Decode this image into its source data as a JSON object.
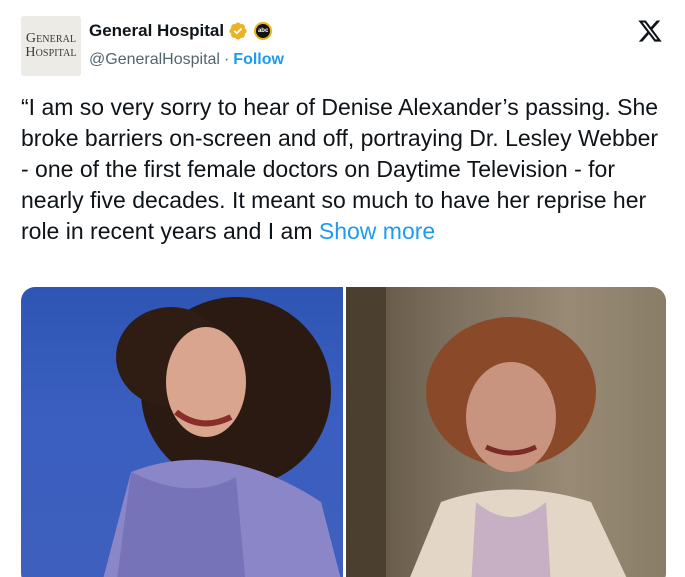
{
  "account": {
    "name": "General Hospital",
    "handle": "@GeneralHospital",
    "separator": "·",
    "follow_label": "Follow",
    "avatar_text_line1": "General",
    "avatar_text_line2": "Hospital",
    "affiliate_badge_text": "abc",
    "verified": true
  },
  "tweet": {
    "text": "“I am so very sorry to hear of Denise Alexander’s passing. She broke barriers on-screen and off, portraying Dr. Lesley Webber - one of the first female doctors on Daytime Television - for nearly five decades. It meant so much to have her reprise her role in recent years and I am ",
    "show_more_label": "Show more"
  },
  "media": {
    "count": 2,
    "images": [
      {
        "description_icon": "photo-left",
        "background": "#3a5fc0"
      },
      {
        "description_icon": "photo-right",
        "background": "#8a7d68"
      }
    ]
  },
  "colors": {
    "accent": "#1d9bf0",
    "text": "#0f1419",
    "secondary": "#536471",
    "verified_gold": "#e8b423"
  }
}
